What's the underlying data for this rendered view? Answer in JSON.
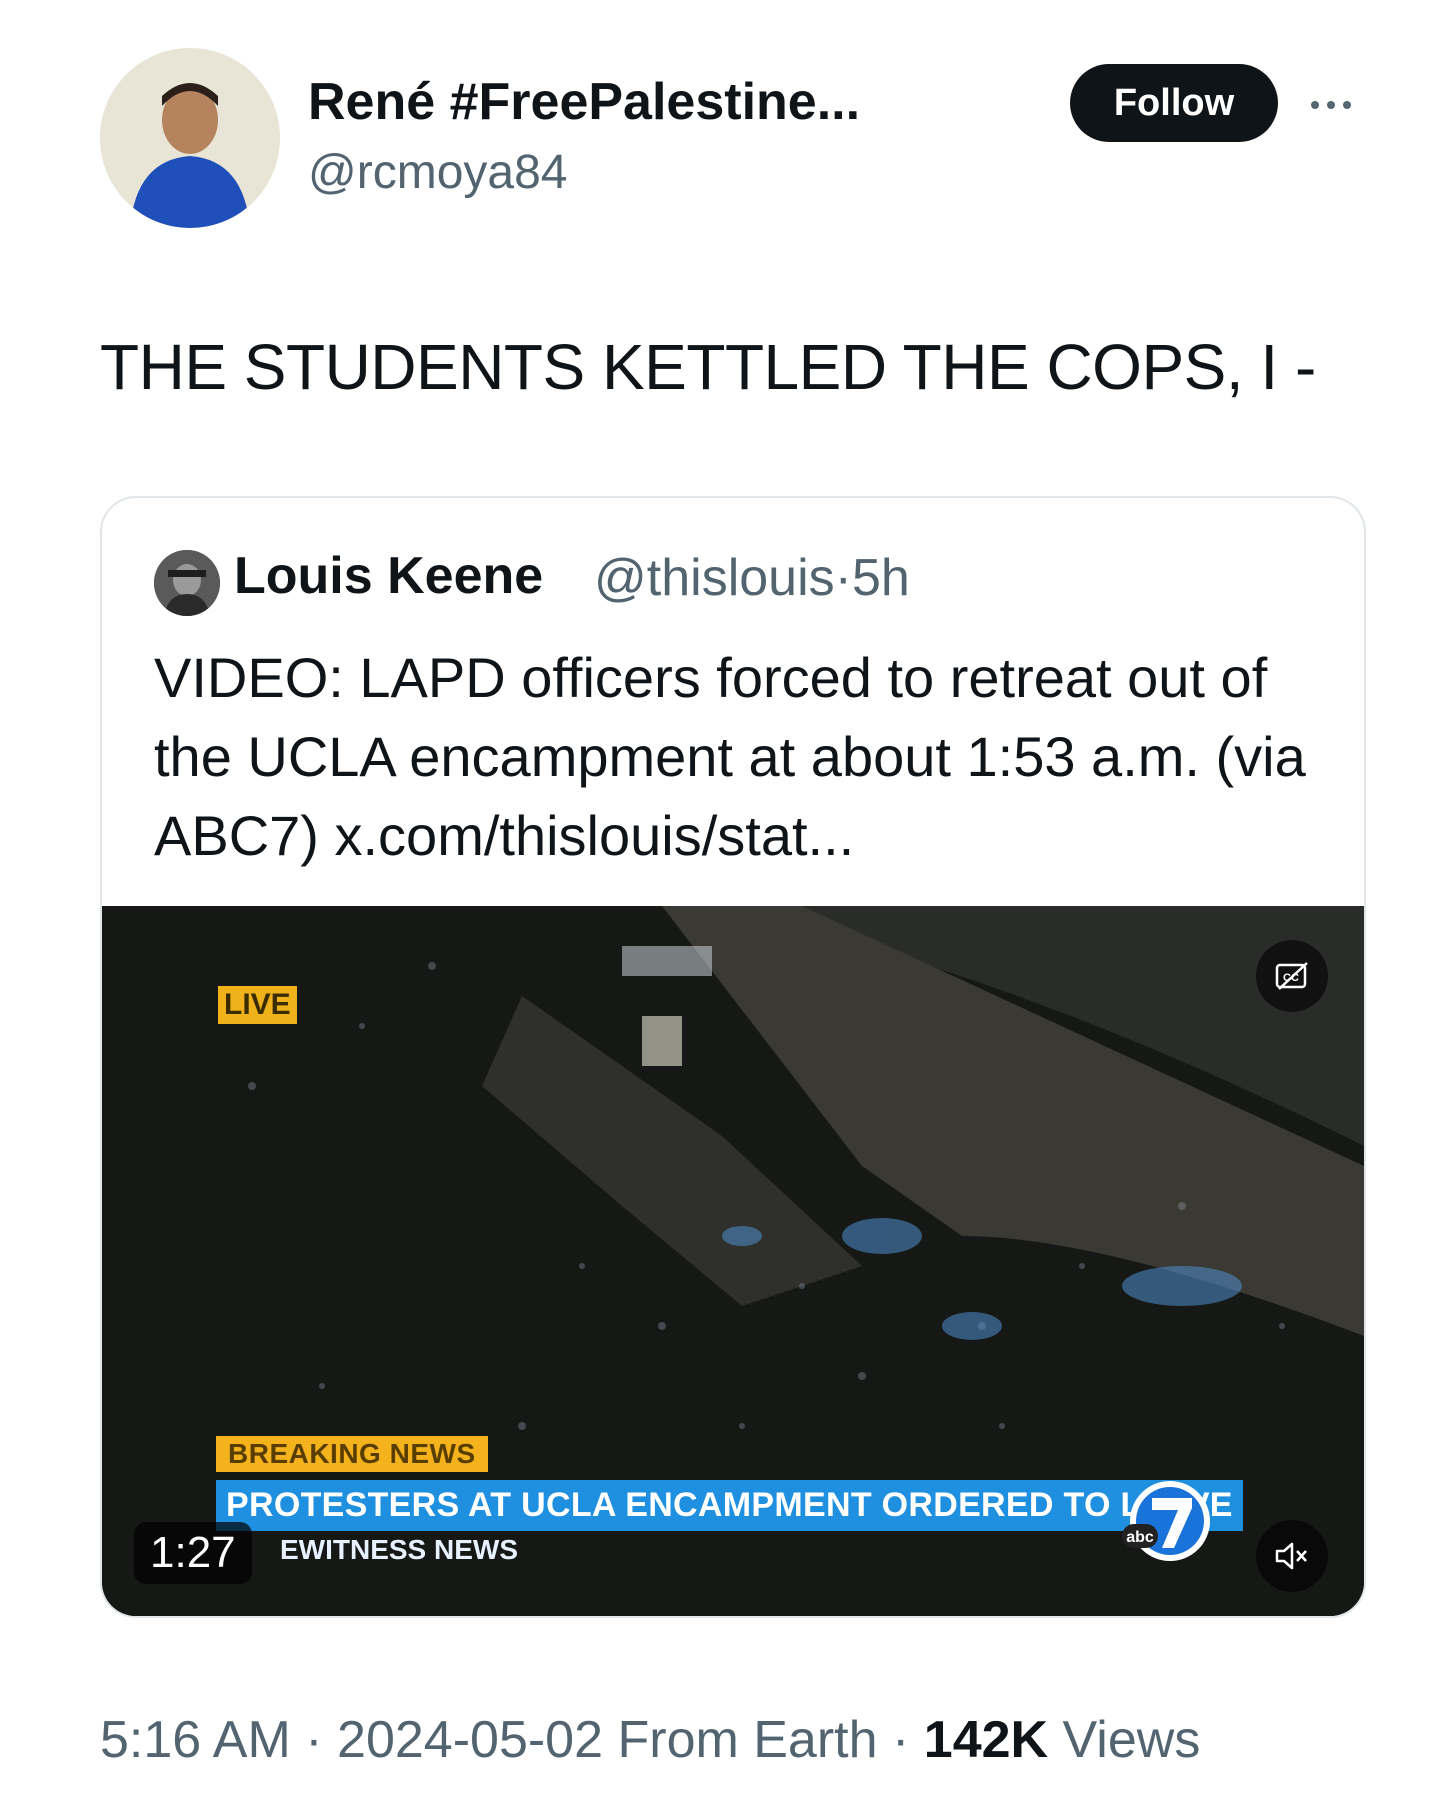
{
  "author": {
    "display_name": "René #FreePalestine...",
    "handle": "@rcmoya84",
    "follow_label": "Follow"
  },
  "tweet": {
    "text": "THE STUDENTS KETTLED THE COPS, I -"
  },
  "quoted": {
    "name": "Louis Keene",
    "handle": "@thislouis",
    "separator": "·",
    "age": "5h",
    "text": "VIDEO: LAPD officers forced to retreat out of the UCLA encampment at about 1:53 a.m. (via ABC7) x.com/thislouis/stat...",
    "video": {
      "live_label": "LIVE",
      "breaking_label": "BREAKING NEWS",
      "headline": "PROTESTERS AT UCLA ENCAMPMENT ORDERED TO LEAVE",
      "program": "EWITNESS NEWS",
      "duration": "1:27",
      "network_logo_text": "abc",
      "channel_number": "7"
    }
  },
  "meta": {
    "time": "5:16 AM",
    "date": "2024-05-02",
    "location": "From Earth",
    "views_count": "142K",
    "views_label": "Views",
    "dot": "·"
  },
  "icons": {
    "more": "more-horizontal-icon",
    "captions": "captions-off-icon",
    "mute": "volume-muted-icon"
  }
}
